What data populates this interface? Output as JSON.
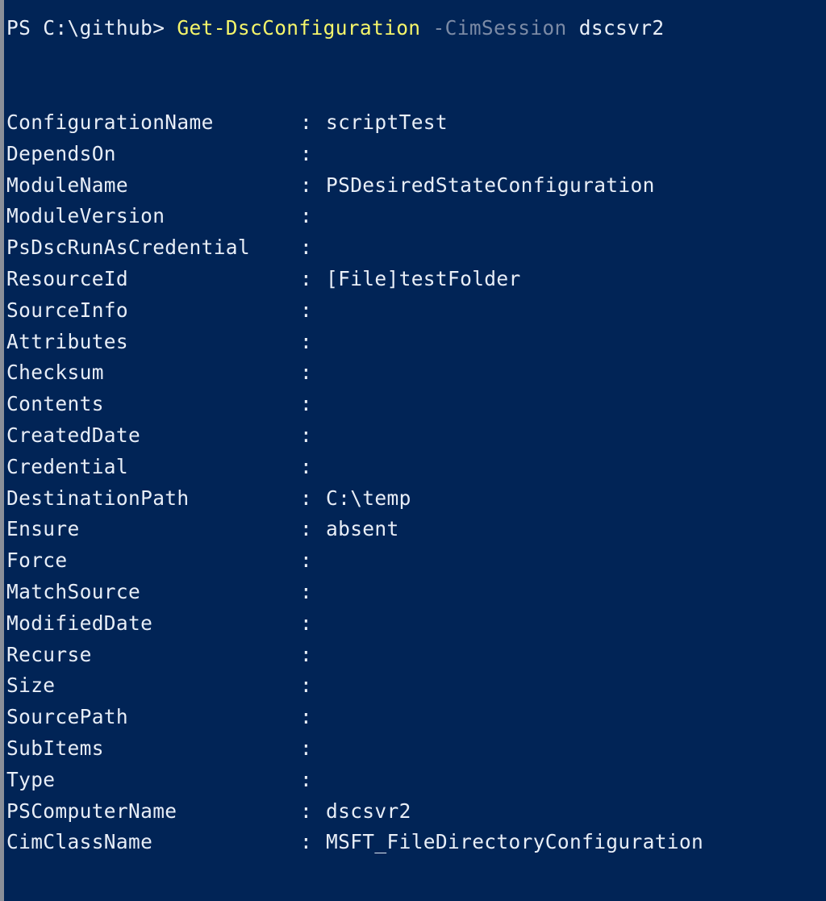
{
  "prompt": {
    "text": "PS C:\\github> ",
    "cmdlet": "Get-DscConfiguration",
    "parameter": "-CimSession",
    "argument": "dscsvr2"
  },
  "colors": {
    "background": "#012456",
    "cmdlet": "#f5f56a",
    "parameter": "#7b8aa5",
    "text": "#e8eef7"
  },
  "output": [
    {
      "key": "ConfigurationName",
      "value": "scriptTest"
    },
    {
      "key": "DependsOn",
      "value": ""
    },
    {
      "key": "ModuleName",
      "value": "PSDesiredStateConfiguration"
    },
    {
      "key": "ModuleVersion",
      "value": ""
    },
    {
      "key": "PsDscRunAsCredential",
      "value": ""
    },
    {
      "key": "ResourceId",
      "value": "[File]testFolder"
    },
    {
      "key": "SourceInfo",
      "value": ""
    },
    {
      "key": "Attributes",
      "value": ""
    },
    {
      "key": "Checksum",
      "value": ""
    },
    {
      "key": "Contents",
      "value": ""
    },
    {
      "key": "CreatedDate",
      "value": ""
    },
    {
      "key": "Credential",
      "value": ""
    },
    {
      "key": "DestinationPath",
      "value": "C:\\temp"
    },
    {
      "key": "Ensure",
      "value": "absent"
    },
    {
      "key": "Force",
      "value": ""
    },
    {
      "key": "MatchSource",
      "value": ""
    },
    {
      "key": "ModifiedDate",
      "value": ""
    },
    {
      "key": "Recurse",
      "value": ""
    },
    {
      "key": "Size",
      "value": ""
    },
    {
      "key": "SourcePath",
      "value": ""
    },
    {
      "key": "SubItems",
      "value": ""
    },
    {
      "key": "Type",
      "value": ""
    },
    {
      "key": "PSComputerName",
      "value": "dscsvr2"
    },
    {
      "key": "CimClassName",
      "value": "MSFT_FileDirectoryConfiguration"
    }
  ],
  "separator": ":"
}
